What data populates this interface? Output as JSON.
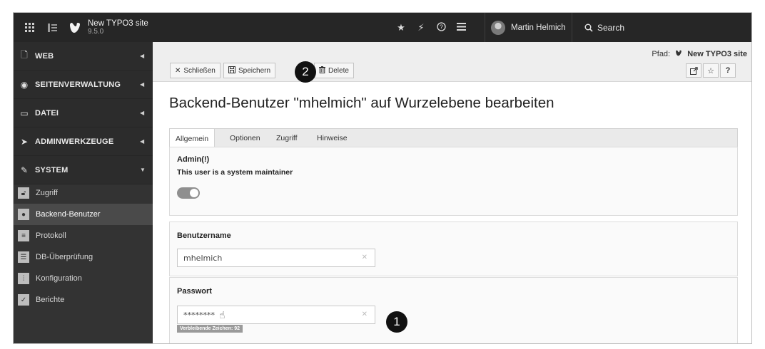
{
  "topbar": {
    "site_title": "New TYPO3 site",
    "site_version": "9.5.0",
    "user_name": "Martin Helmich",
    "search_label": "Search",
    "icons": [
      "grid-icon",
      "sidebar-toggle-icon",
      "typo3-logo-icon",
      "star-icon",
      "flash-icon",
      "help-icon",
      "list-icon",
      "avatar",
      "search-icon"
    ]
  },
  "sidebar": {
    "groups": [
      {
        "label": "WEB",
        "icon": "page-icon"
      },
      {
        "label": "SEITENVERWALTUNG",
        "icon": "globe-icon"
      },
      {
        "label": "DATEI",
        "icon": "image-icon"
      },
      {
        "label": "ADMINWERKZEUGE",
        "icon": "rocket-icon"
      },
      {
        "label": "SYSTEM",
        "icon": "plug-icon"
      }
    ],
    "items": [
      {
        "label": "Zugriff",
        "icon": "lock-icon"
      },
      {
        "label": "Backend-Benutzer",
        "icon": "user-icon",
        "active": true
      },
      {
        "label": "Protokoll",
        "icon": "log-icon"
      },
      {
        "label": "DB-Überprüfung",
        "icon": "database-icon"
      },
      {
        "label": "Konfiguration",
        "icon": "sliders-icon"
      },
      {
        "label": "Berichte",
        "icon": "report-icon"
      }
    ]
  },
  "docheader": {
    "close_label": "Schließen",
    "save_label": "Speichern",
    "delete_label": "Delete",
    "path_prefix": "Pfad:",
    "path_site": "New TYPO3 site",
    "help_label": "?"
  },
  "callouts": {
    "one": "1",
    "two": "2"
  },
  "form": {
    "title": "Backend-Benutzer \"mhelmich\" auf Wurzelebene bearbeiten",
    "tabs": [
      "Allgemein",
      "Optionen",
      "Zugriff",
      "Hinweise"
    ],
    "admin_label": "Admin(!)",
    "admin_desc": "This user is a system maintainer",
    "admin_enabled": true,
    "username_label": "Benutzername",
    "username_value": "mhelmich",
    "password_label": "Passwort",
    "password_value": "********",
    "remaining_chars": "Verbleibende Zeichen: 92"
  },
  "colors": {
    "topbar": "#262626",
    "sidebar": "#333333",
    "active_item": "#4a4a4a",
    "callout": "#111111"
  }
}
